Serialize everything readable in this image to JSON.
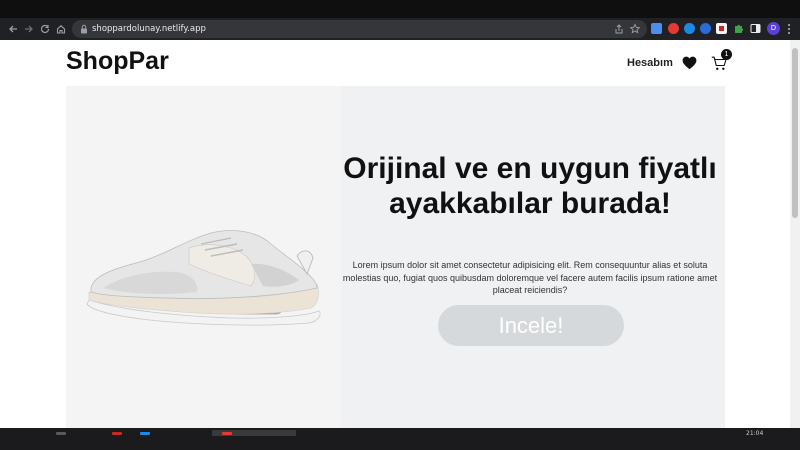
{
  "browser": {
    "url": "shoppardolunay.netlify.app",
    "profile_initial": "D",
    "icons": [
      "back-arrow-icon",
      "forward-arrow-icon",
      "reload-icon",
      "home-icon",
      "lock-icon",
      "share-icon",
      "bookmark-star-icon",
      "extensions-puzzle-icon",
      "sidebar-icon",
      "menu-dots-icon"
    ],
    "extension_colors": [
      "#4a8ff0",
      "#e53935",
      "#1e88e5",
      "#43a047",
      "#c62828",
      "#26a69a",
      "#43a047"
    ]
  },
  "header": {
    "logo": "ShopPar",
    "account_label": "Hesabım",
    "cart_count": "1",
    "icons": [
      "heart-icon",
      "cart-icon"
    ]
  },
  "hero": {
    "title": "Orijinal ve en uygun fiyatlı ayakkabılar burada!",
    "description": "Lorem ipsum dolor sit amet consectetur adipisicing elit. Rem consequuntur alias et soluta molestias quo, fugiat quos quibusdam doloremque vel facere autem facilis ipsum ratione amet placeat reiciendis?",
    "button_label": "Incele!",
    "image": "sneaker-image"
  },
  "taskbar": {
    "clock": "21:04"
  },
  "colors": {
    "hero_bg": "#eff1f3",
    "button_bg": "#d6d9dc",
    "chrome_bg": "#202124"
  }
}
